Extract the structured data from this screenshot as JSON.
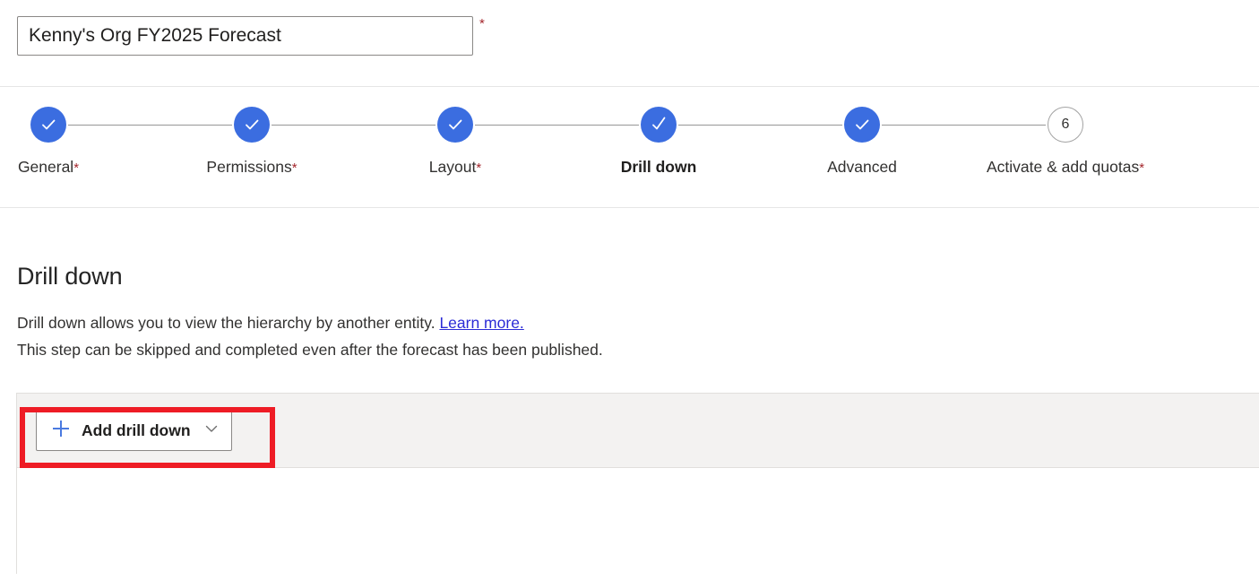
{
  "header": {
    "forecast_name_value": "Kenny's Org FY2025 Forecast",
    "forecast_name_placeholder": "Forecast name",
    "required_marker": "*"
  },
  "stepper": {
    "steps": [
      {
        "index": "1",
        "label": "General",
        "required": true,
        "state": "done",
        "current": false,
        "icon": "check-icon"
      },
      {
        "index": "2",
        "label": "Permissions",
        "required": true,
        "state": "done",
        "current": false,
        "icon": "check-icon"
      },
      {
        "index": "3",
        "label": "Layout",
        "required": true,
        "state": "done",
        "current": false,
        "icon": "check-icon"
      },
      {
        "index": "4",
        "label": "Drill down",
        "required": false,
        "state": "done",
        "current": true,
        "icon": "check-icon"
      },
      {
        "index": "5",
        "label": "Advanced",
        "required": false,
        "state": "done",
        "current": false,
        "icon": "check-icon"
      },
      {
        "index": "6",
        "label": "Activate & add quotas",
        "required": true,
        "state": "pending",
        "current": false,
        "icon": "step-number"
      }
    ],
    "required_marker": "*"
  },
  "main": {
    "page_title": "Drill down",
    "description_line1": "Drill down allows you to view the hierarchy by another entity.",
    "learn_more_link": "Learn more.",
    "description_line2": "This step can be skipped and completed even after the forecast has been published."
  },
  "toolbar": {
    "add_drill_down_label": "Add drill down",
    "add_icon": "plus-icon",
    "caret_icon": "chevron-down-icon"
  },
  "colors": {
    "accent_blue": "#3b6de0",
    "plus_blue": "#4a7ae0",
    "required_red": "#a4262c",
    "link_blue": "#2b2bd6",
    "annotation_red": "#ee1c25",
    "command_bar_bg": "#f3f2f1",
    "divider": "#e6e6e6"
  }
}
